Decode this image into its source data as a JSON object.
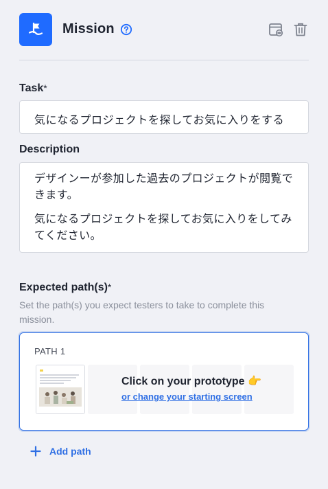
{
  "header": {
    "title": "Mission",
    "mission_icon": "flag-icon",
    "help_icon": "help-circle-icon",
    "actions": [
      "preview-icon",
      "trash-icon"
    ]
  },
  "task": {
    "label": "Task",
    "required_mark": "*",
    "value": "気になるプロジェクトを探してお気に入りをする"
  },
  "description": {
    "label": "Description",
    "paragraphs": [
      "デザインーが参加した過去のプロジェクトが閲覧できます。",
      "気になるプロジェクトを探してお気に入りをしてみてください。"
    ]
  },
  "expected_paths": {
    "label": "Expected path(s)",
    "required_mark": "*",
    "hint": "Set the path(s) you expect testers to take to complete this mission.",
    "paths": [
      {
        "label": "PATH 1",
        "cta_title": "Click on your prototype 👉",
        "cta_link": "or change your starting screen"
      }
    ],
    "add_label": "Add path"
  },
  "colors": {
    "accent": "#1f6bff",
    "link": "#2f6fe4",
    "background": "#f0f1f6"
  }
}
